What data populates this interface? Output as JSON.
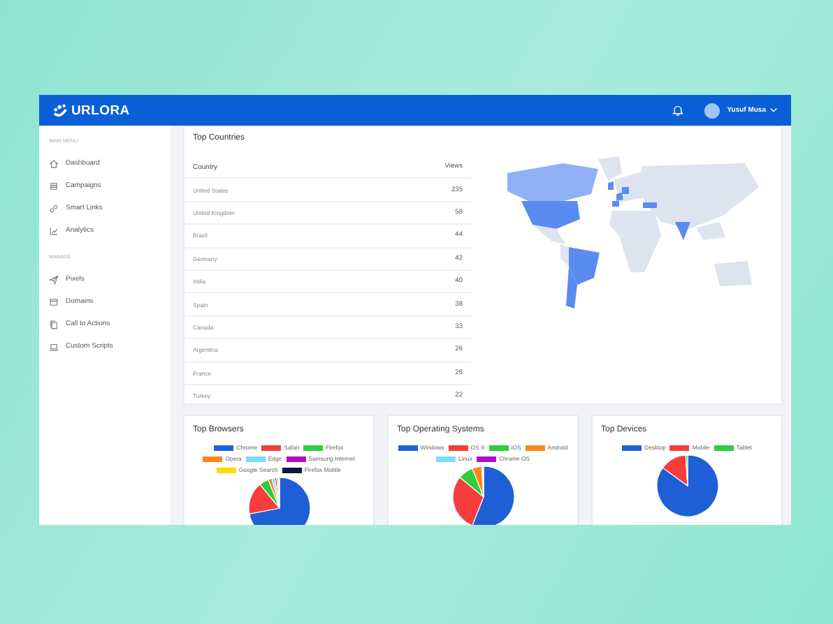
{
  "header": {
    "brand": "URLORA",
    "user": "Yusuf Musa"
  },
  "sidebar": {
    "sections": [
      {
        "heading": "MAIN MENU",
        "items": [
          {
            "label": "Dashboard",
            "kind": "home"
          },
          {
            "label": "Campaigns",
            "kind": "stack"
          },
          {
            "label": "Smart Links",
            "kind": "link"
          },
          {
            "label": "Analytics",
            "kind": "chart"
          }
        ]
      },
      {
        "heading": "MANAGE",
        "items": [
          {
            "label": "Pixels",
            "kind": "plane"
          },
          {
            "label": "Domains",
            "kind": "window"
          },
          {
            "label": "Call to Actions",
            "kind": "copy"
          },
          {
            "label": "Custom Scripts",
            "kind": "laptop"
          }
        ]
      }
    ]
  },
  "top_countries": {
    "title": "Top Countries",
    "columns": [
      "Country",
      "Views"
    ],
    "rows": [
      [
        "United States",
        "235"
      ],
      [
        "United Kingdom",
        "58"
      ],
      [
        "Brazil",
        "44"
      ],
      [
        "Germany",
        "42"
      ],
      [
        "India",
        "40"
      ],
      [
        "Spain",
        "38"
      ],
      [
        "Canada",
        "33"
      ],
      [
        "Argentina",
        "26"
      ],
      [
        "France",
        "26"
      ],
      [
        "Turkey",
        "22"
      ]
    ]
  },
  "panels": [
    {
      "title": "Top Browsers",
      "legend": [
        {
          "label": "Chrome",
          "color": "#1f5fd6"
        },
        {
          "label": "Safari",
          "color": "#f73c3c"
        },
        {
          "label": "Firefox",
          "color": "#2ecc40"
        },
        {
          "label": "Opera",
          "color": "#ff851b"
        },
        {
          "label": "Edge",
          "color": "#7fdbff"
        },
        {
          "label": "Samsung Internet",
          "color": "#b10dc9"
        },
        {
          "label": "Google Search",
          "color": "#ffdc00"
        },
        {
          "label": "Firefox Mobile",
          "color": "#0b1a3a"
        }
      ]
    },
    {
      "title": "Top Operating Systems",
      "legend": [
        {
          "label": "Windows",
          "color": "#1f5fd6"
        },
        {
          "label": "OS X",
          "color": "#f73c3c"
        },
        {
          "label": "iOS",
          "color": "#2ecc40"
        },
        {
          "label": "Android",
          "color": "#ff851b"
        },
        {
          "label": "Linux",
          "color": "#7fdbff"
        },
        {
          "label": "Chrome OS",
          "color": "#b10dc9"
        }
      ]
    },
    {
      "title": "Top Devices",
      "legend": [
        {
          "label": "Desktop",
          "color": "#1f5fd6"
        },
        {
          "label": "Mobile",
          "color": "#f73c3c"
        },
        {
          "label": "Tablet",
          "color": "#2ecc40"
        }
      ]
    }
  ]
}
